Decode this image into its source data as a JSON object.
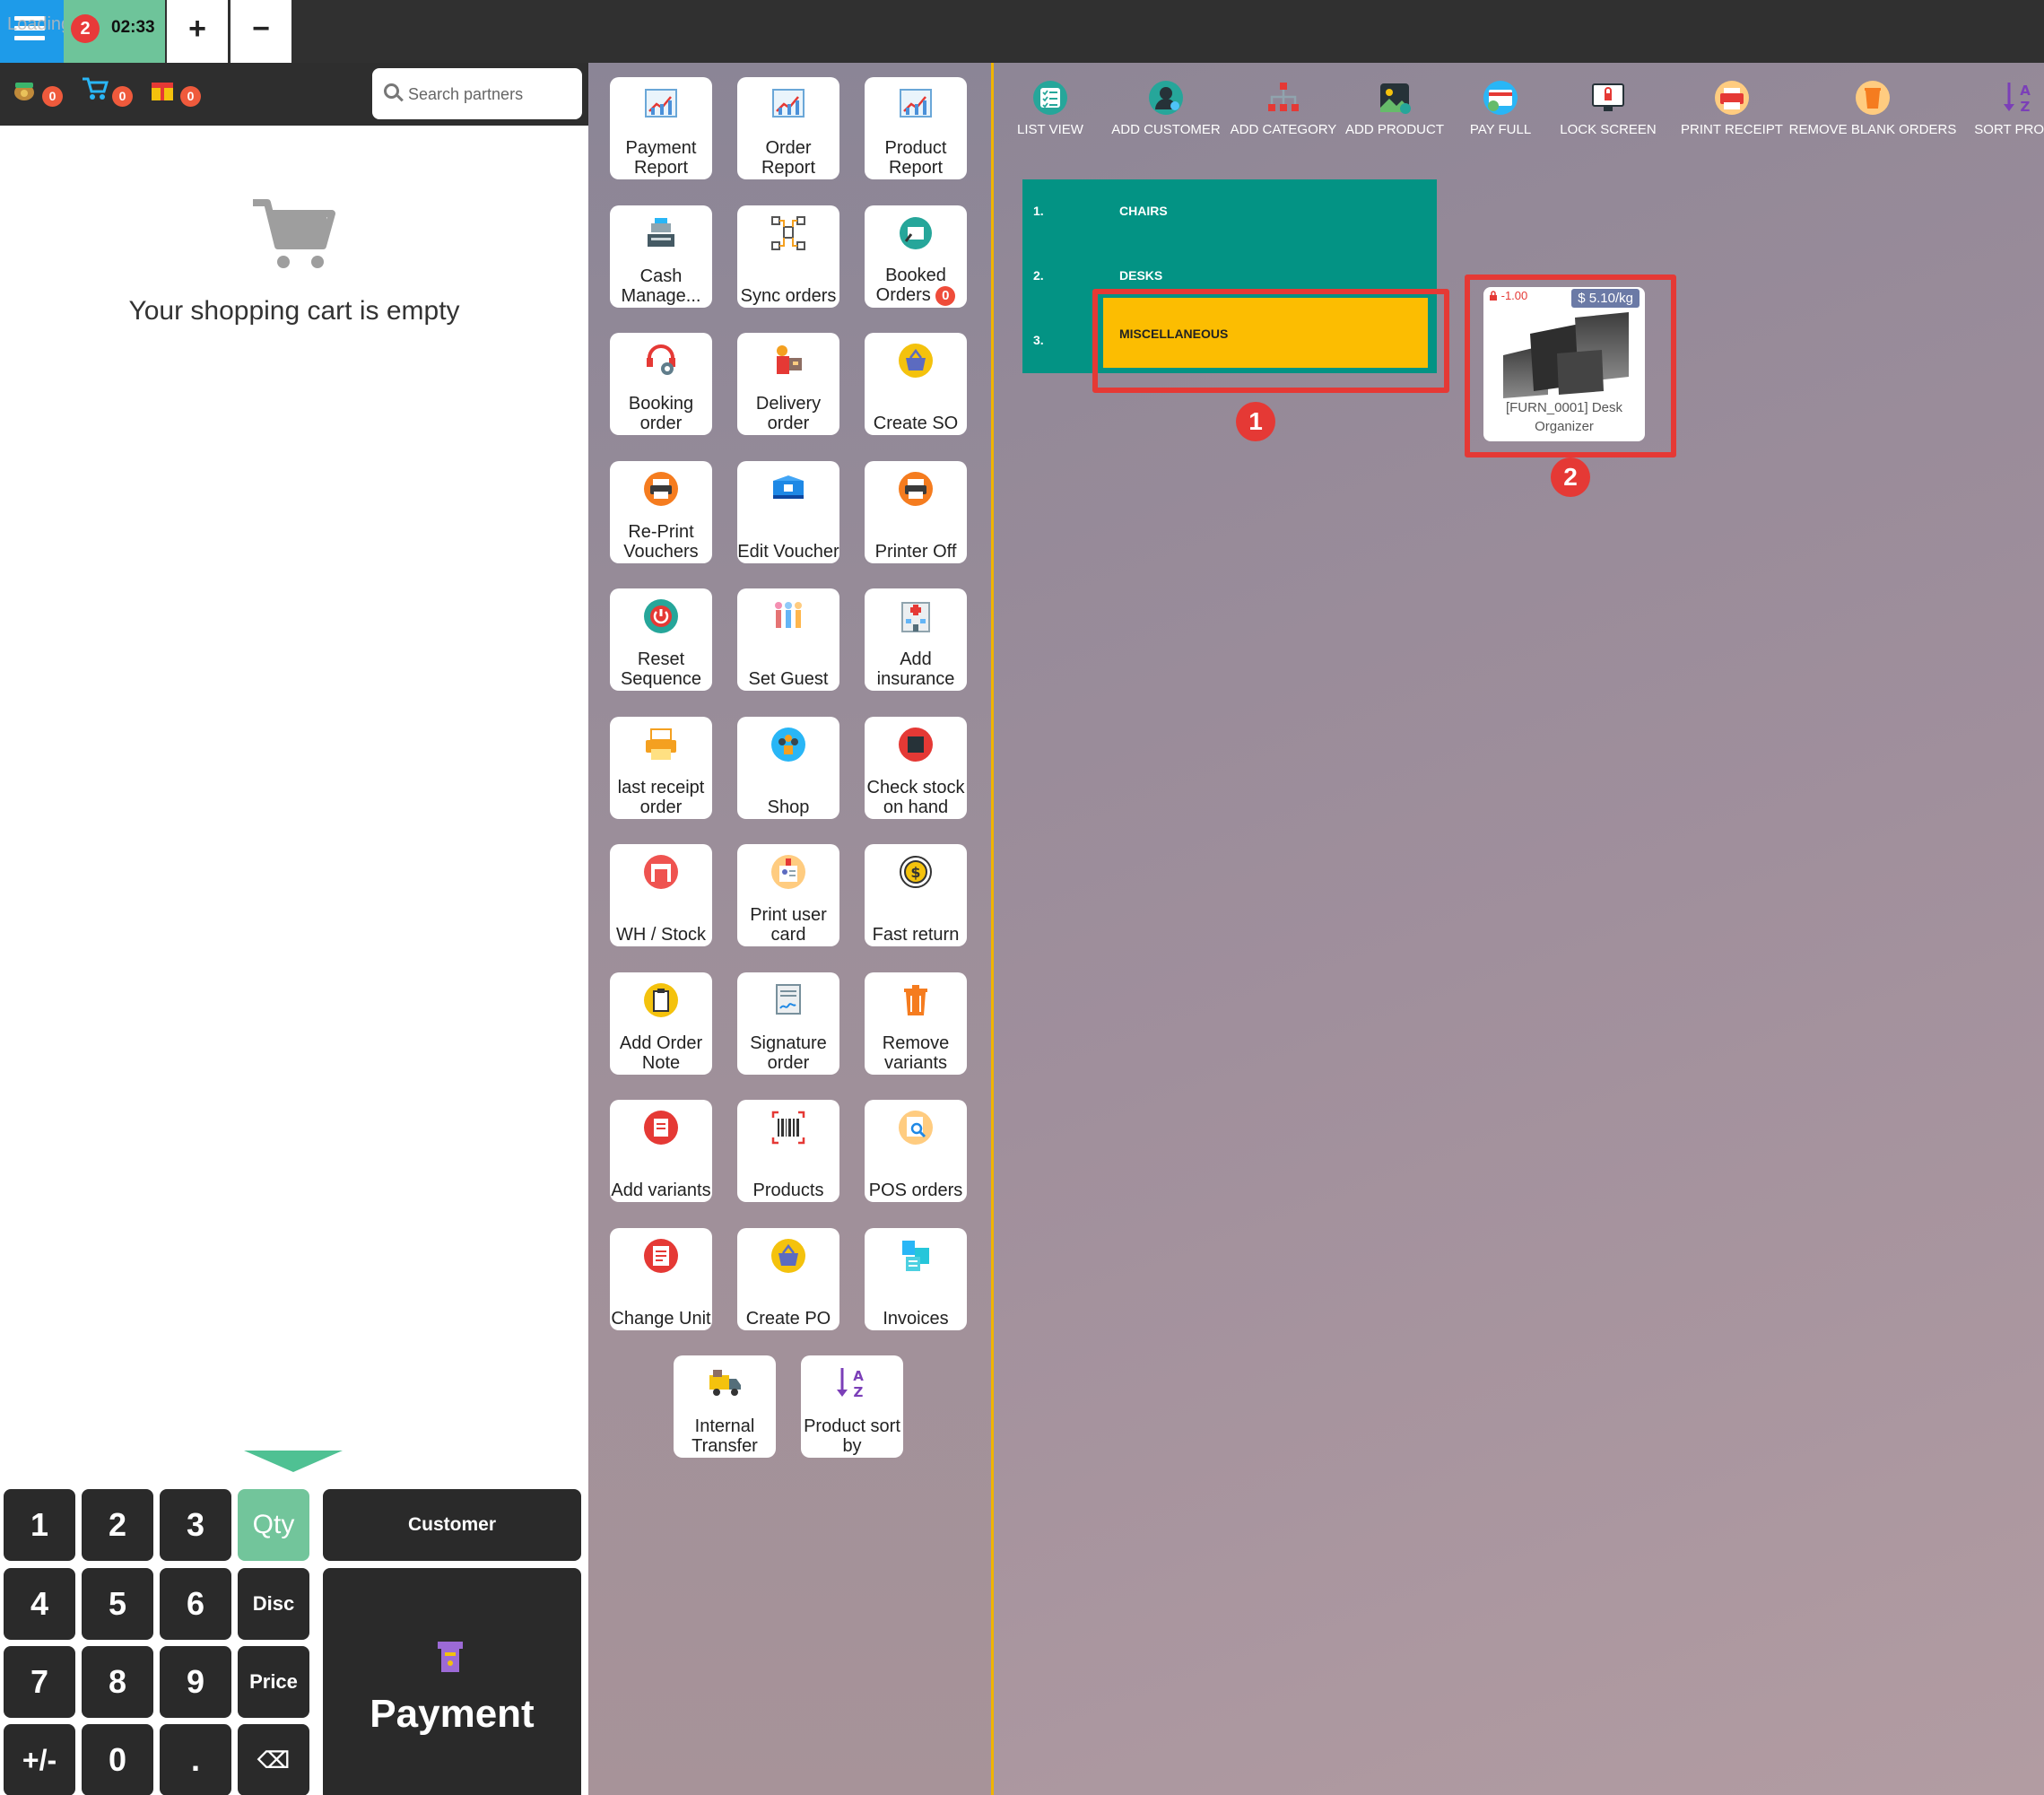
{
  "topbar": {
    "loading_text": "Loading...",
    "order_count": "2",
    "order_time": "02:33",
    "add_label": "+",
    "remove_label": "−"
  },
  "left": {
    "counters": [
      {
        "icon": "money-bag-icon",
        "count": "0"
      },
      {
        "icon": "cart-icon",
        "count": "0"
      },
      {
        "icon": "gift-icon",
        "count": "0"
      }
    ],
    "search_placeholder": "Search partners",
    "empty_cart_text": "Your shopping cart is empty"
  },
  "numpad": {
    "keys": [
      "1",
      "2",
      "3",
      "Qty",
      "4",
      "5",
      "6",
      "Disc",
      "7",
      "8",
      "9",
      "Price",
      "+/-",
      "0",
      ".",
      "⌫"
    ],
    "customer_label": "Customer",
    "payment_label": "Payment"
  },
  "functions": [
    {
      "label": "Payment Report",
      "icon": "chart-icon"
    },
    {
      "label": "Order Report",
      "icon": "chart-icon"
    },
    {
      "label": "Product Report",
      "icon": "chart-icon"
    },
    {
      "label": "Cash Manage...",
      "icon": "cash-register-icon"
    },
    {
      "label": "Sync orders",
      "icon": "sync-network-icon"
    },
    {
      "label": "Booked Orders",
      "icon": "booked-orders-icon",
      "badge": "0"
    },
    {
      "label": "Booking order",
      "icon": "booking-icon"
    },
    {
      "label": "Delivery order",
      "icon": "delivery-icon"
    },
    {
      "label": "Create SO",
      "icon": "basket-icon"
    },
    {
      "label": "Re-Print Vouchers",
      "icon": "printer-icon"
    },
    {
      "label": "Edit Voucher",
      "icon": "voucher-icon"
    },
    {
      "label": "Printer Off",
      "icon": "printer-icon"
    },
    {
      "label": "Reset Sequence",
      "icon": "power-icon"
    },
    {
      "label": "Set Guest",
      "icon": "guests-icon"
    },
    {
      "label": "Add insurance",
      "icon": "hospital-icon"
    },
    {
      "label": "last receipt order",
      "icon": "receipt-printer-icon"
    },
    {
      "label": "Shop",
      "icon": "shop-team-icon"
    },
    {
      "label": "Check stock on hand",
      "icon": "stock-icon"
    },
    {
      "label": "WH / Stock",
      "icon": "warehouse-icon"
    },
    {
      "label": "Print user card",
      "icon": "id-card-icon"
    },
    {
      "label": "Fast return",
      "icon": "dollar-coin-icon"
    },
    {
      "label": "Add Order Note",
      "icon": "note-icon"
    },
    {
      "label": "Signature order",
      "icon": "signature-icon"
    },
    {
      "label": "Remove variants",
      "icon": "trash-icon"
    },
    {
      "label": "Add variants",
      "icon": "document-add-icon"
    },
    {
      "label": "Products",
      "icon": "barcode-icon"
    },
    {
      "label": "POS orders",
      "icon": "search-document-icon"
    },
    {
      "label": "Change Unit",
      "icon": "document-change-icon"
    },
    {
      "label": "Create PO",
      "icon": "basket-icon"
    },
    {
      "label": "Invoices",
      "icon": "invoices-icon"
    },
    {
      "label": "Internal Transfer",
      "icon": "truck-icon"
    },
    {
      "label": "Product sort by",
      "icon": "sort-az-icon"
    }
  ],
  "toolbar": [
    {
      "label": "LIST VIEW",
      "icon": "list-view-icon"
    },
    {
      "label": "ADD CUSTOMER",
      "icon": "add-customer-icon"
    },
    {
      "label": "ADD CATEGORY",
      "icon": "add-category-icon"
    },
    {
      "label": "ADD PRODUCT",
      "icon": "add-product-icon"
    },
    {
      "label": "PAY FULL",
      "icon": "pay-full-icon"
    },
    {
      "label": "LOCK SCREEN",
      "icon": "lock-screen-icon"
    },
    {
      "label": "PRINT RECEIPT",
      "icon": "print-receipt-icon"
    },
    {
      "label": "REMOVE BLANK ORDERS",
      "icon": "remove-orders-icon"
    },
    {
      "label": "SORT PRODU",
      "icon": "sort-az-icon"
    }
  ],
  "categories": [
    {
      "num": "1.",
      "name": "CHAIRS"
    },
    {
      "num": "2.",
      "name": "DESKS"
    },
    {
      "num": "3.",
      "name": "MISCELLANEOUS",
      "selected": true
    }
  ],
  "product": {
    "stock": "-1.00",
    "price": "$ 5.10/kg",
    "name": "[FURN_0001] Desk Organizer"
  },
  "markers": [
    "1",
    "2"
  ],
  "colors": {
    "accent_blue": "#1e9be9",
    "order_green": "#6ec49a",
    "category_teal": "#039384",
    "selected_yellow": "#fcbd01",
    "highlight_red": "#e53935"
  }
}
